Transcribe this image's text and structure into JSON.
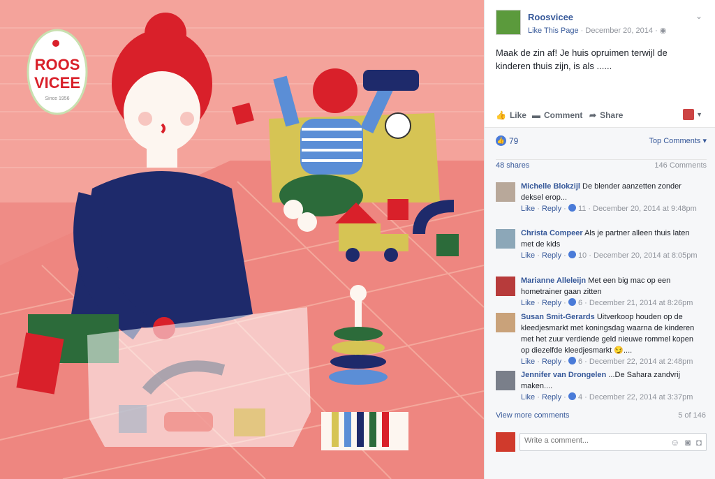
{
  "post": {
    "page_name": "Roosvicee",
    "like_page": "Like This Page",
    "date": "December 20, 2014",
    "separator": "·",
    "text": "Maak de zin af! Je huis opruimen terwijl de kinderen thuis zijn, is als ......",
    "actions": {
      "like": "Like",
      "comment": "Comment",
      "share": "Share"
    }
  },
  "logo": {
    "line1": "ROOS",
    "line2": "VICEE",
    "since": "Since 1956"
  },
  "stats": {
    "likes": "79",
    "top_comments": "Top Comments ▾",
    "shares": "48 shares",
    "comments": "146 Comments"
  },
  "comments": [
    {
      "author": "Michelle Blokzijl",
      "text": "De blender aanzetten zonder deksel erop...",
      "like": "Like",
      "reply": "Reply",
      "count": "11",
      "date": "December 20, 2014 at 9:48pm"
    },
    {
      "author": "Christa Compeer",
      "text": "Als je partner alleen thuis laten met de kids",
      "like": "Like",
      "reply": "Reply",
      "count": "10",
      "date": "December 20, 2014 at 8:05pm"
    },
    {
      "author": "Marianne Alleleijn",
      "text": "Met een big mac op een hometrainer gaan zitten",
      "like": "Like",
      "reply": "Reply",
      "count": "6",
      "date": "December 21, 2014 at 8:26pm"
    },
    {
      "author": "Susan Smit-Gerards",
      "text": "Uitverkoop houden op de kleedjesmarkt met koningsdag waarna de kinderen met het zuur verdiende geld nieuwe rommel kopen op diezelfde kleedjesmarkt 😏....",
      "like": "Like",
      "reply": "Reply",
      "count": "6",
      "date": "December 22, 2014 at 2:48pm"
    },
    {
      "author": "Jennifer van Drongelen",
      "text": "...De Sahara zandvrij maken....",
      "like": "Like",
      "reply": "Reply",
      "count": "4",
      "date": "December 22, 2014 at 3:37pm"
    }
  ],
  "footer": {
    "view_more": "View more comments",
    "view_count": "5 of 146",
    "write_placeholder": "Write a comment..."
  },
  "colors": {
    "link": "#365899",
    "bg_photo": "#ef8c86",
    "accent_blue": "#4a7bd8"
  }
}
